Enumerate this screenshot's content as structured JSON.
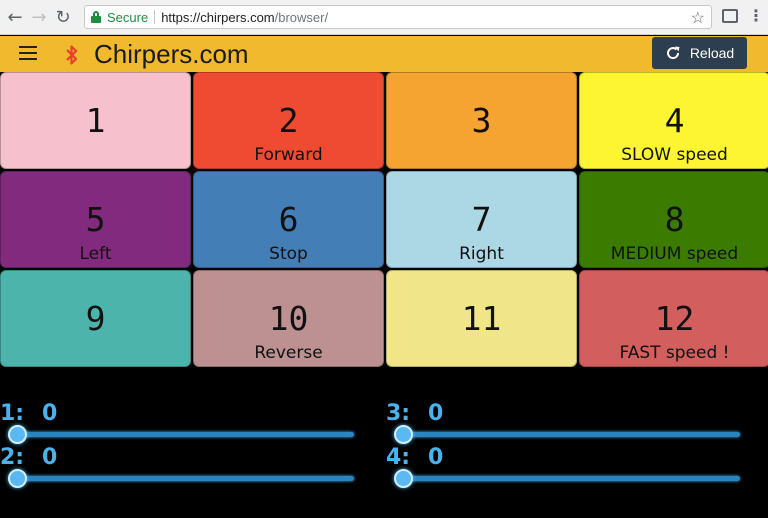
{
  "browser": {
    "secure_label": "Secure",
    "url_host": "https://chirpers.com",
    "url_path": "/browser/"
  },
  "header": {
    "title": "Chirpers.com",
    "reload_label": "Reload"
  },
  "buttons": [
    {
      "num": "1",
      "label": "",
      "color": "#f6c1cc"
    },
    {
      "num": "2",
      "label": "Forward",
      "color": "#ef4a32"
    },
    {
      "num": "3",
      "label": "",
      "color": "#f5a431"
    },
    {
      "num": "4",
      "label": "SLOW speed",
      "color": "#fdf531"
    },
    {
      "num": "5",
      "label": "Left",
      "color": "#822a7e"
    },
    {
      "num": "6",
      "label": "Stop",
      "color": "#437fb6"
    },
    {
      "num": "7",
      "label": "Right",
      "color": "#acd7e5"
    },
    {
      "num": "8",
      "label": "MEDIUM speed",
      "color": "#3b7c00"
    },
    {
      "num": "9",
      "label": "",
      "color": "#4cb4ab"
    },
    {
      "num": "10",
      "label": "Reverse",
      "color": "#bd9091"
    },
    {
      "num": "11",
      "label": "",
      "color": "#f1e58a"
    },
    {
      "num": "12",
      "label": "FAST speed !",
      "color": "#d25f5e"
    }
  ],
  "sliders": [
    {
      "label": "1:",
      "value": "0",
      "fraction": 0
    },
    {
      "label": "2:",
      "value": "0",
      "fraction": 0
    },
    {
      "label": "3:",
      "value": "0",
      "fraction": 0
    },
    {
      "label": "4:",
      "value": "0",
      "fraction": 0
    }
  ]
}
